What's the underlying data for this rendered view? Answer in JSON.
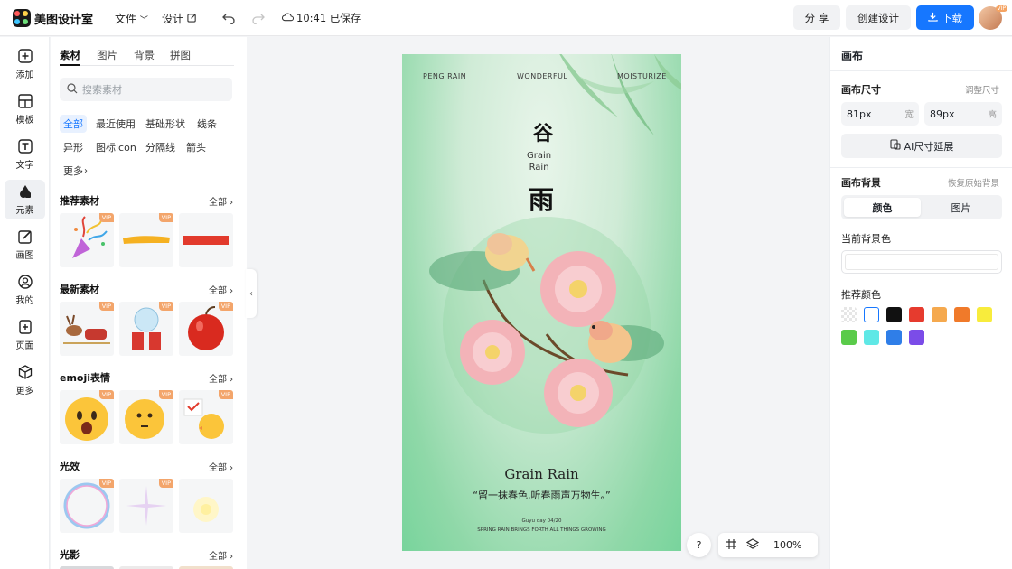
{
  "app": {
    "name": "美图设计室"
  },
  "topbar": {
    "file_label": "文件",
    "design_label": "设计",
    "saved_status": "10:41 已保存",
    "share_label": "分 享",
    "create_label": "创建设计",
    "download_label": "下载",
    "avatar_badge": "VIP"
  },
  "rail": {
    "items": [
      {
        "label": "添加",
        "icon": "plus-square-icon"
      },
      {
        "label": "模板",
        "icon": "template-icon"
      },
      {
        "label": "文字",
        "icon": "text-icon"
      },
      {
        "label": "元素",
        "icon": "shapes-icon",
        "active": true
      },
      {
        "label": "画图",
        "icon": "draw-icon"
      },
      {
        "label": "我的",
        "icon": "user-icon"
      },
      {
        "label": "页面",
        "icon": "page-add-icon"
      },
      {
        "label": "更多",
        "icon": "cube-icon"
      }
    ]
  },
  "panel": {
    "tabs": [
      "素材",
      "图片",
      "背景",
      "拼图"
    ],
    "search_placeholder": "搜索素材",
    "chips": [
      "全部",
      "最近使用",
      "基础形状",
      "线条",
      "异形",
      "图标icon",
      "分隔线",
      "箭头",
      "更多"
    ],
    "all_label": "全部",
    "vip": "VIP",
    "sections": [
      {
        "title": "推荐素材",
        "items": [
          "confetti-popper",
          "yellow-brush-stroke",
          "red-bar"
        ]
      },
      {
        "title": "最新素材",
        "items": [
          "reindeer-sleigh",
          "snow-globe-gift",
          "red-apple"
        ]
      },
      {
        "title": "emoji表情",
        "items": [
          "shocked-emoji",
          "thinking-emoji",
          "chick-emoji"
        ]
      },
      {
        "title": "光效",
        "items": [
          "bubble-ring",
          "sparkle-star",
          "soft-glow"
        ]
      },
      {
        "title": "光影",
        "items": []
      }
    ]
  },
  "canvas": {
    "top_words": [
      "PENG RAIN",
      "WONDERFUL",
      "MOISTURIZE"
    ],
    "gu": "谷",
    "grain_small": [
      "Grain",
      "Rain"
    ],
    "yu": "雨",
    "title": "Grain Rain",
    "quote": "“留一抹春色,听春雨声万物生。”",
    "small_line1": "Guyu day 04/20",
    "small_line2": "SPRING RAIN BRINGS FORTH ALL THINGS GROWING"
  },
  "floating": {
    "help": "?",
    "zoom": "100%"
  },
  "right": {
    "title": "画布",
    "size_label": "画布尺寸",
    "adjust_size": "调整尺寸",
    "width_value": "81px",
    "width_unit": "宽",
    "height_value": "89px",
    "height_unit": "高",
    "ai_extend": "AI尺寸延展",
    "bg_label": "画布背景",
    "restore_bg": "恢复原始背景",
    "seg_color": "颜色",
    "seg_image": "图片",
    "current_bg": "当前背景色",
    "recommend": "推荐颜色",
    "colors": [
      "transparent",
      "#ffffff",
      "#111111",
      "#e63b2e",
      "#f5a94e",
      "#f07a2a",
      "#f8ec3c",
      "#5acb4a",
      "#5fe8e6",
      "#2f7ee8",
      "#7b4ce8"
    ]
  }
}
